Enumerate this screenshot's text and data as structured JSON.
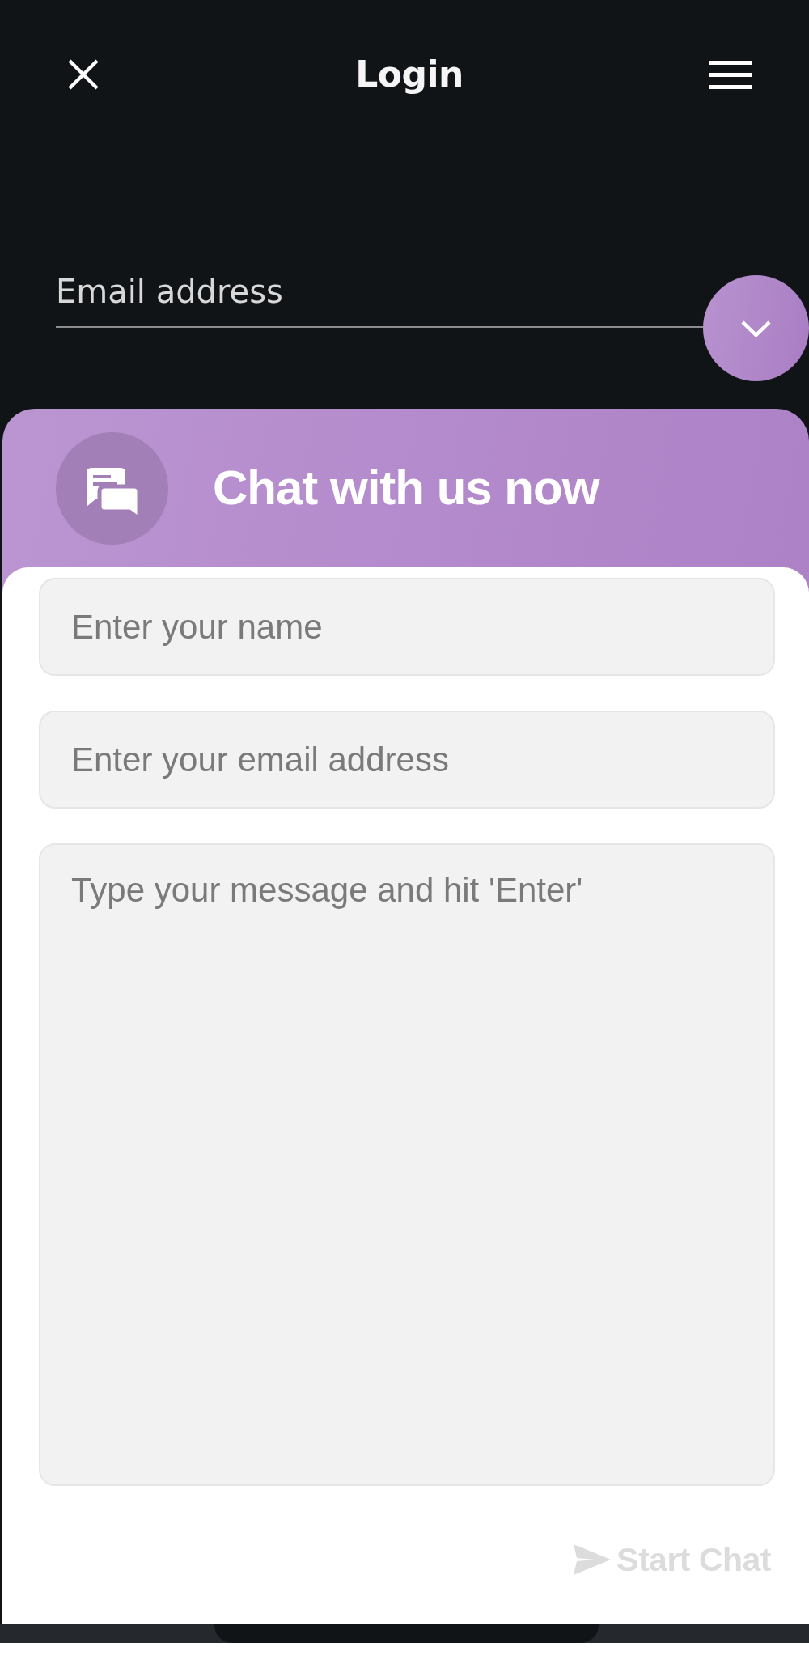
{
  "header": {
    "title": "Login"
  },
  "login_form": {
    "email_field": {
      "placeholder": "Email address"
    }
  },
  "chat_widget": {
    "title": "Chat with us now",
    "fields": [
      {
        "kind": "input",
        "placeholder": "Enter your name"
      },
      {
        "kind": "input",
        "placeholder": "Enter your email address"
      },
      {
        "kind": "textarea",
        "placeholder": "Type your message and hit 'Enter'"
      }
    ],
    "start_button": {
      "label": "Start Chat",
      "disabled": true
    }
  }
}
